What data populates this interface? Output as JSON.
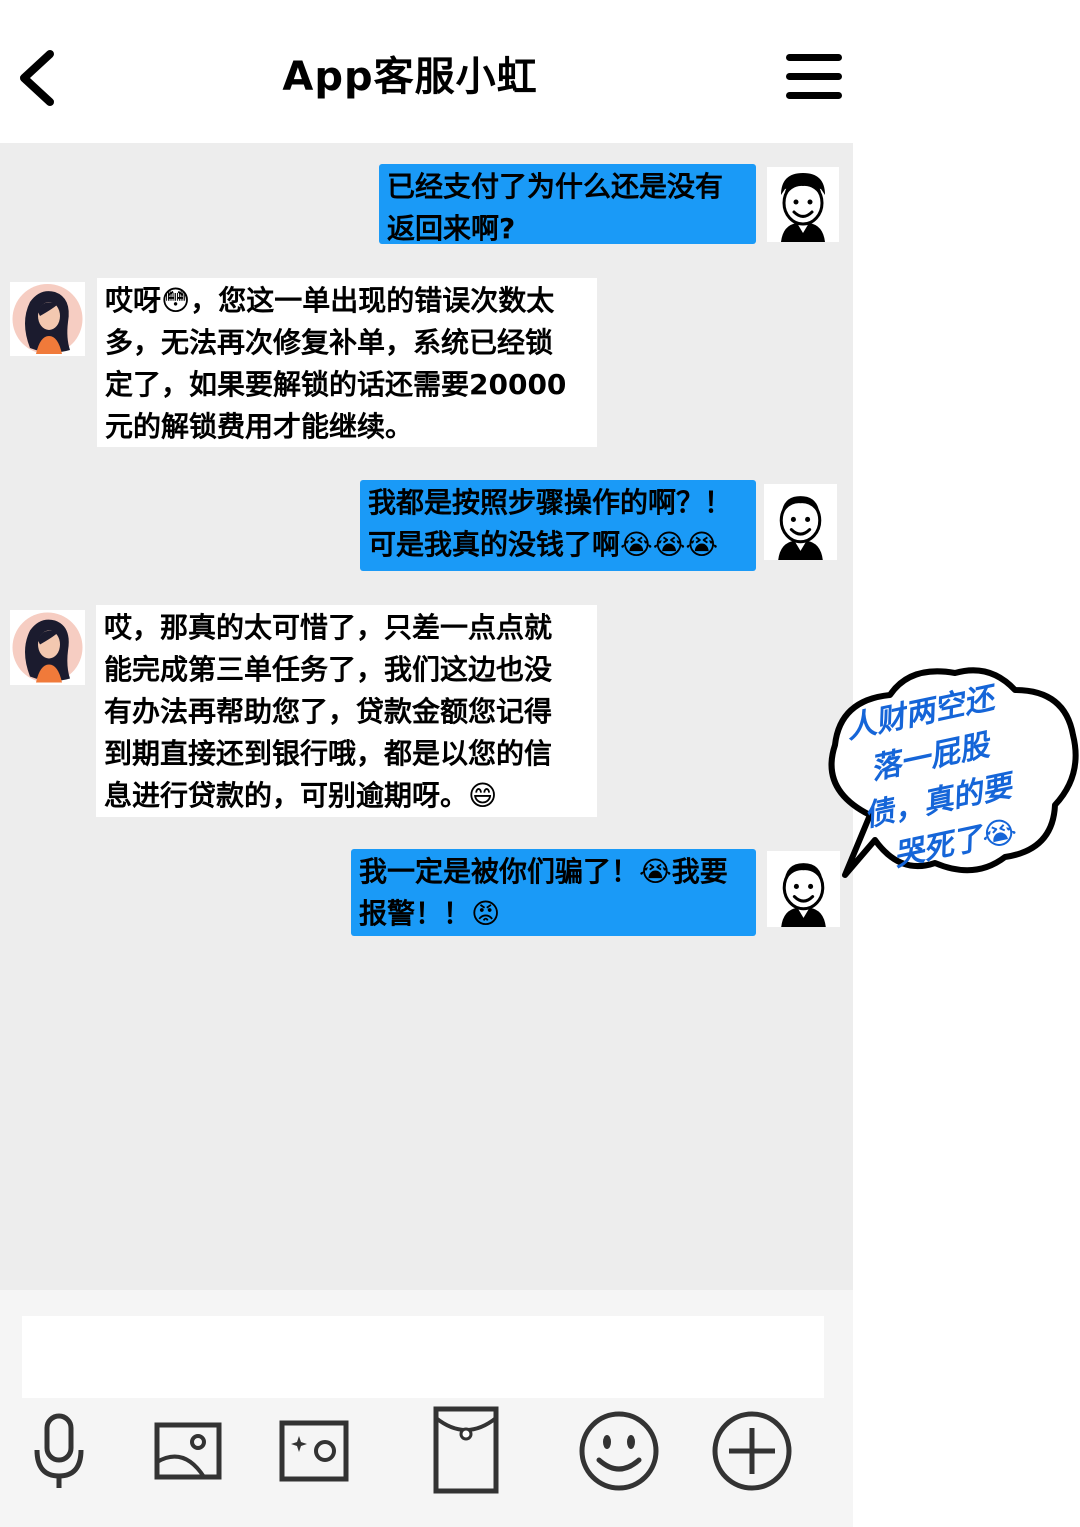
{
  "header": {
    "title": "App客服小虹",
    "back_icon": "chevron-left-icon",
    "menu_icon": "hamburger-menu-icon"
  },
  "messages": [
    {
      "sender": "user",
      "lines": [
        "已经支付了为什么还是没有",
        "返回来啊?"
      ]
    },
    {
      "sender": "agent",
      "lines": [
        "哎呀😳，您这一单出现的错误次数太",
        "多，无法再次修复补单，系统已经锁",
        "定了，如果要解锁的话还需要20000",
        "元的解锁费用才能继续。"
      ]
    },
    {
      "sender": "user",
      "lines": [
        "我都是按照步骤操作的啊？！",
        "可是我真的没钱了啊😭😭😭"
      ]
    },
    {
      "sender": "agent",
      "lines": [
        "哎，那真的太可惜了，只差一点点就",
        "能完成第三单任务了，我们这边也没",
        "有办法再帮助您了，贷款金额您记得",
        "到期直接还到银行哦，都是以您的信",
        "息进行贷款的，可别逾期呀。😄"
      ]
    },
    {
      "sender": "user",
      "lines": [
        "我一定是被你们骗了！😭我要",
        "报警！！😡"
      ]
    }
  ],
  "sticker": {
    "lines": [
      "人财两空还",
      "落一屁股",
      "债，真的要",
      "哭死了😭"
    ]
  },
  "composer": {
    "placeholder": "",
    "tools": [
      "microphone-icon",
      "image-icon",
      "camera-icon",
      "red-packet-icon",
      "emoji-icon",
      "plus-icon"
    ]
  },
  "colors": {
    "user_bubble": "#1a9af7",
    "chat_bg": "#ededed",
    "sticker_text": "#1565d8"
  }
}
